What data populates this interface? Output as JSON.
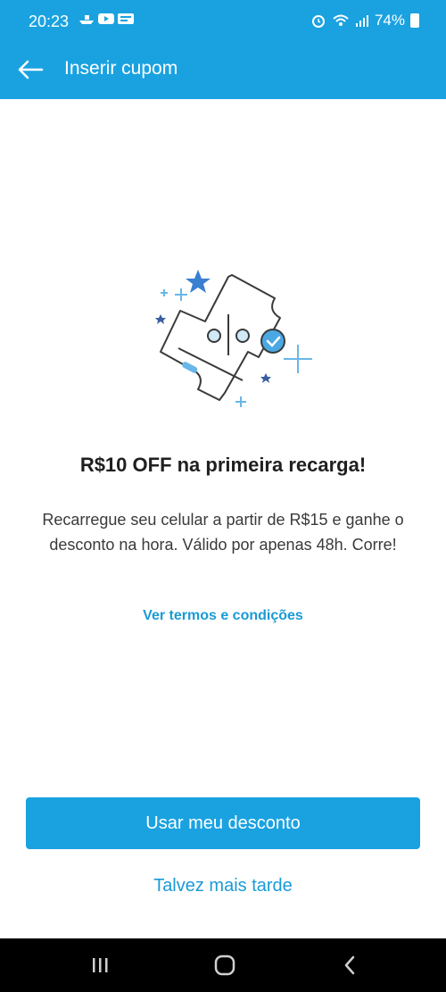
{
  "status_bar": {
    "time": "20:23",
    "battery": "74%",
    "icons": [
      "boat-icon",
      "youtube-icon",
      "notification-icon",
      "alarm-icon",
      "wifi-icon",
      "signal-icon",
      "battery-icon"
    ]
  },
  "app_bar": {
    "title": "Inserir cupom",
    "back_icon": "arrow-left-icon"
  },
  "colors": {
    "brand": "#1aa2e0",
    "link": "#1a9ad6",
    "star": "#3a7fd0"
  },
  "content": {
    "illustration": "coupon-ticket-icon",
    "headline": "R$10 OFF na primeira recarga!",
    "description": "Recarregue seu celular a partir de R$15 e ganhe o desconto na hora. Válido por apenas 48h. Corre!",
    "terms_link": "Ver termos e condições"
  },
  "actions": {
    "primary": "Usar meu desconto",
    "secondary": "Talvez mais tarde"
  },
  "nav_bar": {
    "items": [
      "recent-apps-icon",
      "home-icon",
      "back-icon"
    ]
  }
}
